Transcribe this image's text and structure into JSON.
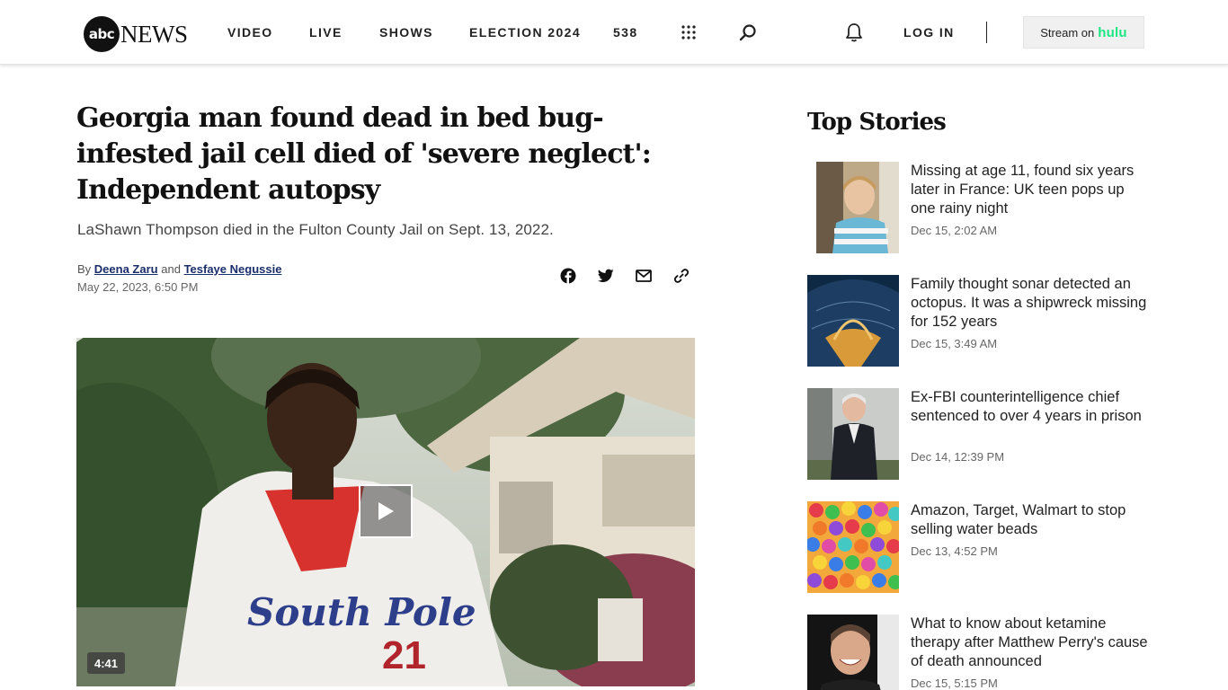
{
  "header": {
    "logo_abc": "abc",
    "logo_news": "NEWS",
    "nav": [
      "VIDEO",
      "LIVE",
      "SHOWS",
      "ELECTION 2024",
      "538"
    ],
    "login": "LOG IN",
    "stream_text": "Stream on",
    "stream_brand": "hulu"
  },
  "article": {
    "headline": "Georgia man found dead in bed bug-infested jail cell died of 'severe neglect': Independent autopsy",
    "dek": "LaShawn Thompson died in the Fulton County Jail on Sept. 13, 2022.",
    "by": "By",
    "author1": "Deena Zaru",
    "and": "and",
    "author2": "Tesfaye Negussie",
    "date": "May 22, 2023, 6:50 PM",
    "video_duration": "4:41"
  },
  "sidebar": {
    "title": "Top Stories",
    "stories": [
      {
        "title": "Missing at age 11, found six years later in France: UK teen pops up one rainy night",
        "time": "Dec 15, 2:02 AM"
      },
      {
        "title": "Family thought sonar detected an octopus. It was a shipwreck missing for 152 years",
        "time": "Dec 15, 3:49 AM"
      },
      {
        "title": "Ex-FBI counterintelligence chief sentenced to over 4 years in prison",
        "time": "Dec 14, 12:39 PM"
      },
      {
        "title": "Amazon, Target, Walmart to stop selling water beads",
        "time": "Dec 13, 4:52 PM"
      },
      {
        "title": "What to know about ketamine therapy after Matthew Perry's cause of death announced",
        "time": "Dec 15, 5:15 PM"
      }
    ]
  },
  "colors": {
    "hulu": "#1ce783",
    "author_link": "#1a2e6b"
  },
  "icons": [
    "apps-grid-icon",
    "search-icon",
    "bell-icon",
    "facebook-icon",
    "twitter-icon",
    "email-icon",
    "link-icon",
    "play-icon"
  ]
}
